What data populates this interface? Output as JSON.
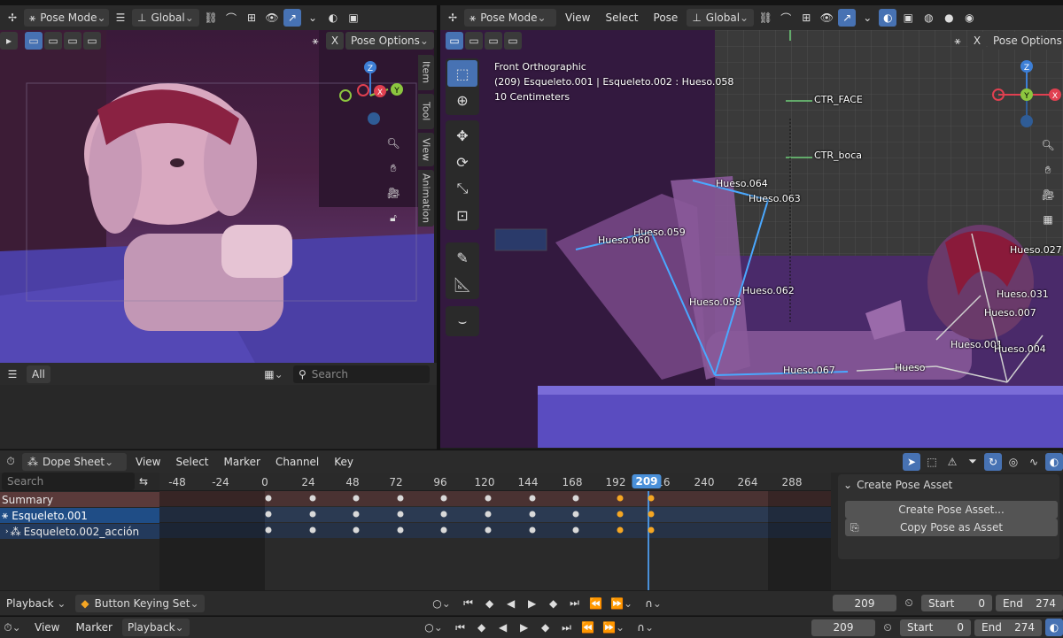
{
  "left_header": {
    "mode": "Pose Mode",
    "orientation": "Global",
    "pose_options": "Pose Options"
  },
  "left_tabs": [
    "Item",
    "Tool",
    "View",
    "Animation"
  ],
  "left_bottom": {
    "filter_tab": "All",
    "search_placeholder": "Search"
  },
  "right_header": {
    "mode": "Pose Mode",
    "menus": [
      "View",
      "Select",
      "Pose"
    ],
    "orientation": "Global",
    "pose_options": "Pose Options"
  },
  "viewport_info": {
    "view": "Front Orthographic",
    "object": "(209) Esqueleto.001 | Esqueleto.002 : Hueso.058",
    "scale": "10 Centimeters"
  },
  "bones": [
    {
      "label": "CTR_FACE"
    },
    {
      "label": "CTR_boca"
    },
    {
      "label": "Hueso.064"
    },
    {
      "label": "Hueso.063"
    },
    {
      "label": "Hueso.059"
    },
    {
      "label": "Hueso.060"
    },
    {
      "label": "Hueso.062"
    },
    {
      "label": "Hueso.058"
    },
    {
      "label": "Hueso.067"
    },
    {
      "label": "Hueso"
    },
    {
      "label": "Hueso.001"
    },
    {
      "label": "Hueso.027"
    },
    {
      "label": "Hueso.031"
    },
    {
      "label": "Hueso.007"
    },
    {
      "label": "Hueso.004"
    }
  ],
  "dopesheet": {
    "editor": "Dope Sheet",
    "menus": [
      "View",
      "Select",
      "Marker",
      "Channel",
      "Key"
    ],
    "search_placeholder": "Search",
    "ruler": [
      "-48",
      "-24",
      "0",
      "24",
      "48",
      "72",
      "96",
      "120",
      "144",
      "168",
      "192",
      "216",
      "240",
      "264",
      "288"
    ],
    "current_frame": "209",
    "channels": [
      "Summary",
      "Esqueleto.001",
      "Esqueleto.002_acción"
    ],
    "keyframes": [
      0,
      24,
      48,
      72,
      96,
      120,
      144,
      168,
      192,
      209
    ],
    "selected_keyframes": [
      192,
      209
    ]
  },
  "pose_asset_panel": {
    "title": "Create Pose Asset",
    "create_button": "Create Pose Asset...",
    "copy_button": "Copy Pose as Asset"
  },
  "ds_footer": {
    "playback": "Playback",
    "keying_set": "Button Keying Set",
    "frame": "209",
    "start_label": "Start",
    "start": "0",
    "end_label": "End",
    "end": "274"
  },
  "timeline_footer": {
    "menus": [
      "View",
      "Marker",
      "Playback"
    ],
    "frame": "209",
    "start_label": "Start",
    "start": "0",
    "end_label": "End",
    "end": "274"
  },
  "colors": {
    "accent": "#4772b3",
    "keyframe": "#d9d9d9",
    "keyframe_selected": "#f5a623",
    "playhead": "#4a90d9"
  }
}
